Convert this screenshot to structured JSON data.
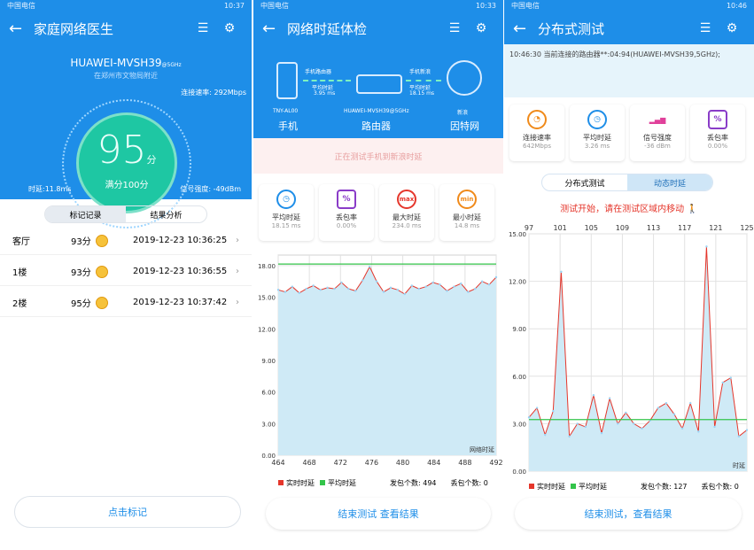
{
  "status": {
    "p1_left": "中国电信",
    "p1_right": "10:37",
    "p2_left": "中国电信",
    "p2_right": "10:33",
    "p3_left": "中国电信",
    "p3_right": "10:46"
  },
  "panel1": {
    "title": "家庭网络医生",
    "ssid": "HUAWEI-MVSH39",
    "ssid_band": "@5GHz",
    "location": "在郑州市文物局附近",
    "score": "95",
    "score_unit": "分",
    "full": "满分100分",
    "speed": "连接速率: 292Mbps",
    "latency": "时延:11.8ms",
    "signal": "信号强度: -49dBm",
    "tabs": [
      "标记记录",
      "结果分析"
    ],
    "records": [
      {
        "room": "客厅",
        "score": "93分",
        "time": "2019-12-23 10:36:25"
      },
      {
        "room": "1楼",
        "score": "93分",
        "time": "2019-12-23 10:36:55"
      },
      {
        "room": "2楼",
        "score": "95分",
        "time": "2019-12-23 10:37:42"
      }
    ],
    "mark_button": "点击标记"
  },
  "panel2": {
    "title": "网络时延体检",
    "phone_label": "手机路由器",
    "phone_avg": "平均时延",
    "phone_avg_val": "3.95 ms",
    "router_label": "手机新浪",
    "router_avg": "平均时延",
    "router_avg_val": "18.15 ms",
    "dev_phone": "TNY-AL00",
    "dev_phone_name": "手机",
    "dev_router": "HUAWEI-MVSH39@5GHz",
    "dev_router_name": "路由器",
    "dev_net": "新浪",
    "dev_net_name": "因特网",
    "testing": "正在测试手机到新浪时延",
    "cards": [
      {
        "name": "平均时延",
        "value": "18.15 ms",
        "icon": "speedometer-icon",
        "color": "#1e8ee8",
        "glyph": "◷"
      },
      {
        "name": "丢包率",
        "value": "0.00%",
        "icon": "percent-icon",
        "color": "#8a3cc8",
        "glyph": "%"
      },
      {
        "name": "最大时延",
        "value": "234.0 ms",
        "icon": "max-gauge-icon",
        "color": "#e5362b",
        "glyph": "max"
      },
      {
        "name": "最小时延",
        "value": "14.8 ms",
        "icon": "min-gauge-icon",
        "color": "#f08a1a",
        "glyph": "min"
      }
    ],
    "legend_real": "实时时延",
    "legend_avg": "平均时延",
    "sent": "发包个数: 494",
    "lost": "丢包个数: 0",
    "end_button": "结束测试  查看结果"
  },
  "panel3": {
    "title": "分布式测试",
    "info": "10:46:30 当前连接的路由器**:04:94(HUAWEI-MVSH39,5GHz);",
    "cards": [
      {
        "name": "连接速率",
        "value": "642Mbps",
        "icon": "gauge-icon",
        "color": "#f08a1a",
        "glyph": "◔"
      },
      {
        "name": "平均时延",
        "value": "3.26 ms",
        "icon": "speedometer-icon",
        "color": "#1e8ee8",
        "glyph": "◷"
      },
      {
        "name": "信号强度",
        "value": "-36 dBm",
        "icon": "signal-bars-icon",
        "color": "#e0409a",
        "glyph": "▂▄▆"
      },
      {
        "name": "丢包率",
        "value": "0.00%",
        "icon": "percent-icon",
        "color": "#8a3cc8",
        "glyph": "%"
      }
    ],
    "tabs": [
      "分布式测试",
      "动态时延"
    ],
    "message": "测试开始，请在测试区域内移动",
    "legend_real": "实时时延",
    "legend_avg": "平均时延",
    "sent": "发包个数: 127",
    "lost": "丢包个数: 0",
    "end_button": "结束测试，查看结果"
  },
  "chart_data": [
    {
      "type": "line",
      "xlabel": "网络时延",
      "x": [
        464,
        468,
        472,
        476,
        480,
        484,
        488,
        492
      ],
      "ylim": [
        0,
        19
      ],
      "yticks": [
        "0.00",
        "3.00",
        "6.00",
        "9.00",
        "12.00",
        "15.00",
        "18.00"
      ],
      "series": [
        {
          "name": "实时时延",
          "color": "#e5362b",
          "values": [
            15.7,
            15.5,
            16.0,
            15.4,
            15.8,
            16.1,
            15.7,
            15.9,
            15.8,
            16.4,
            15.8,
            15.6,
            16.6,
            17.9,
            16.5,
            15.5,
            15.9,
            15.7,
            15.3,
            16.1,
            15.8,
            16.0,
            16.4,
            16.2,
            15.6,
            16.0,
            16.3,
            15.5,
            15.8,
            16.5,
            16.2,
            16.9
          ]
        },
        {
          "name": "平均时延",
          "color": "#33c44a",
          "value": 18.15
        }
      ],
      "fill": "#cfeaf6",
      "grid": true
    },
    {
      "type": "line",
      "xlabel": "时延",
      "x": [
        97,
        101,
        105,
        109,
        113,
        117,
        121,
        125
      ],
      "ylim": [
        0,
        15
      ],
      "yticks": [
        "0.00",
        "3.00",
        "6.00",
        "9.00",
        "12.00",
        "15.00"
      ],
      "series": [
        {
          "name": "实时时延",
          "color": "#e5362b",
          "values": [
            3.4,
            4.0,
            2.3,
            3.8,
            12.6,
            2.2,
            3.0,
            2.8,
            4.8,
            2.4,
            4.6,
            3.0,
            3.7,
            3.0,
            2.7,
            3.2,
            4.0,
            4.3,
            3.6,
            2.7,
            4.3,
            2.5,
            14.2,
            2.8,
            5.6,
            5.9,
            2.2,
            2.6
          ]
        },
        {
          "name": "平均时延",
          "color": "#33c44a",
          "value": 3.26
        }
      ],
      "fill": "#cfeaf6",
      "grid": true
    }
  ]
}
